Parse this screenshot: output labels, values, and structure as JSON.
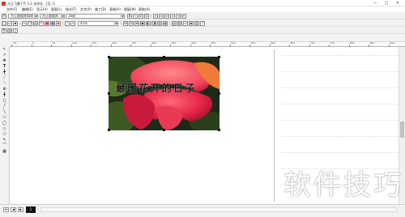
{
  "window": {
    "title": "方正飞腾 FIT 4.1 未命名 - [页 1]",
    "controls": [
      "—",
      "□",
      "✕"
    ]
  },
  "menu": [
    "文件(F)",
    "编辑(E)",
    "显示(V)",
    "版面(L)",
    "格式(T)",
    "文字(X)",
    "美工(D)",
    "表格(A)",
    "视窗(W)",
    "帮助(H)"
  ],
  "toolbar1": {
    "font_cn": "方正超粗黑简体",
    "font_en": "方正超粗黑",
    "size": "16磅"
  },
  "toolbar2": {
    "scale": "45%"
  },
  "tools": [
    "↖",
    "↗",
    "✥",
    "T",
    "╋",
    "⟋",
    "⟍",
    "⊕",
    "╋",
    "◻",
    "╱",
    "╲",
    "▭",
    "◯",
    "◇",
    "⬠",
    "✎",
    "⌒",
    "▦"
  ],
  "ruler_labels": [
    "-50",
    "0",
    "50",
    "100",
    "150",
    "200",
    "250",
    "300",
    "350",
    "400",
    "450",
    "500",
    "550",
    "600",
    "650",
    "700",
    "750",
    "800",
    "850",
    "900"
  ],
  "canvas": {
    "caption": "最暖花开的日子"
  },
  "statusbar": {
    "page": "1"
  },
  "watermark": "软件技巧"
}
